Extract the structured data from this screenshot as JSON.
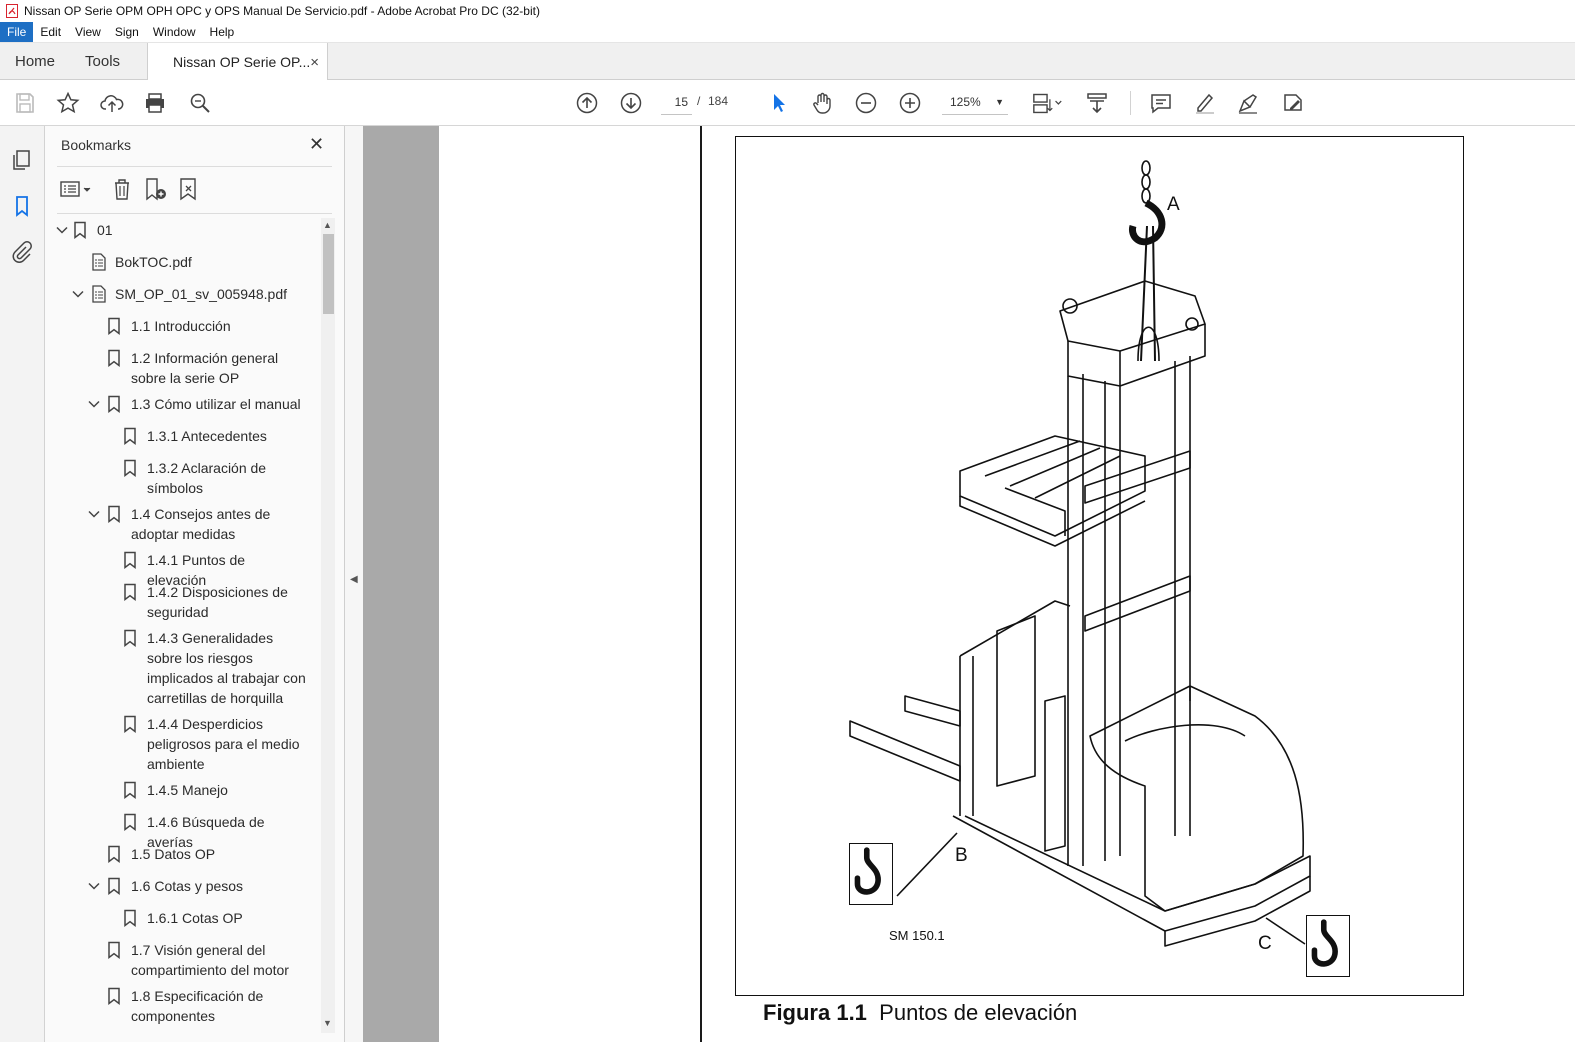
{
  "window": {
    "title": "Nissan OP Serie OPM OPH OPC y OPS Manual De Servicio.pdf - Adobe Acrobat Pro DC (32-bit)"
  },
  "menu": [
    "File",
    "Edit",
    "View",
    "Sign",
    "Window",
    "Help"
  ],
  "tabs": {
    "home": "Home",
    "tools": "Tools",
    "document": "Nissan OP Serie OP...",
    "close": "×"
  },
  "toolbar": {
    "current_page": "15",
    "page_separator": "/",
    "total_pages": "184",
    "zoom": "125%"
  },
  "bookmarks": {
    "title": "Bookmarks",
    "close": "✕",
    "items": [
      {
        "label": "01",
        "icon": "bookmark-icon",
        "expanded": true
      },
      {
        "label": "BokTOC.pdf",
        "icon": "pdf-doc-icon"
      },
      {
        "label": "SM_OP_01_sv_005948.pdf",
        "icon": "pdf-doc-icon",
        "expanded": true
      },
      {
        "label": "1.1 Introducción",
        "icon": "bookmark-icon"
      },
      {
        "label": "1.2 Información general sobre la serie OP",
        "icon": "bookmark-icon"
      },
      {
        "label": "1.3 Cómo utilizar el manual",
        "icon": "bookmark-icon",
        "expanded": true
      },
      {
        "label": "1.3.1 Antecedentes",
        "icon": "bookmark-icon"
      },
      {
        "label": "1.3.2 Aclaración de símbolos",
        "icon": "bookmark-icon"
      },
      {
        "label": "1.4 Consejos antes de adoptar medidas",
        "icon": "bookmark-icon",
        "expanded": true
      },
      {
        "label": "1.4.1 Puntos de elevación",
        "icon": "bookmark-icon"
      },
      {
        "label": "1.4.2 Disposiciones de seguridad",
        "icon": "bookmark-icon"
      },
      {
        "label": "1.4.3 Generalidades sobre los riesgos implicados al trabajar con carretillas de horquilla",
        "icon": "bookmark-icon"
      },
      {
        "label": "1.4.4 Desperdicios peligrosos para el medio ambiente",
        "icon": "bookmark-icon"
      },
      {
        "label": "1.4.5 Manejo",
        "icon": "bookmark-icon"
      },
      {
        "label": "1.4.6 Búsqueda de averías",
        "icon": "bookmark-icon"
      },
      {
        "label": "1.5 Datos OP",
        "icon": "bookmark-icon"
      },
      {
        "label": "1.6 Cotas y pesos",
        "icon": "bookmark-icon",
        "expanded": true
      },
      {
        "label": "1.6.1 Cotas OP",
        "icon": "bookmark-icon"
      },
      {
        "label": "1.7 Visión general del compartimiento del motor",
        "icon": "bookmark-icon"
      },
      {
        "label": "1.8 Especificación de componentes",
        "icon": "bookmark-icon"
      }
    ]
  },
  "figure": {
    "label_a": "A",
    "label_b": "B",
    "label_c": "C",
    "code": "SM 150.1",
    "caption_number": "Figura 1.1",
    "caption_text": "Puntos de elevación"
  }
}
